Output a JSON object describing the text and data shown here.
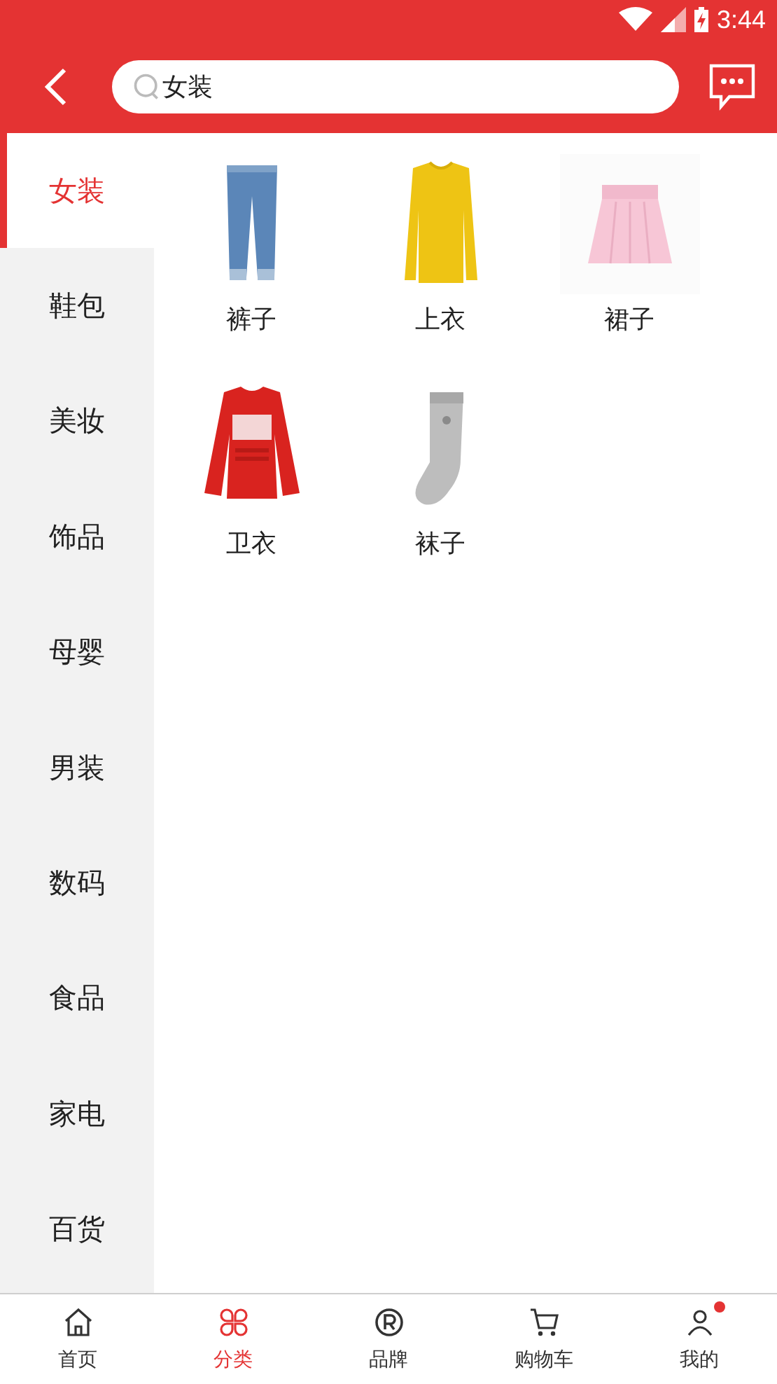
{
  "status_bar": {
    "time": "3:44"
  },
  "header": {
    "search": {
      "value": "女装"
    }
  },
  "sidebar": {
    "items": [
      {
        "label": "女装",
        "selected": true
      },
      {
        "label": "鞋包",
        "selected": false
      },
      {
        "label": "美妆",
        "selected": false
      },
      {
        "label": "饰品",
        "selected": false
      },
      {
        "label": "母婴",
        "selected": false
      },
      {
        "label": "男装",
        "selected": false
      },
      {
        "label": "数码",
        "selected": false
      },
      {
        "label": "食品",
        "selected": false
      },
      {
        "label": "家电",
        "selected": false
      },
      {
        "label": "百货",
        "selected": false
      }
    ]
  },
  "products": [
    {
      "label": "裤子",
      "kind": "pants"
    },
    {
      "label": "上衣",
      "kind": "top"
    },
    {
      "label": "裙子",
      "kind": "skirt"
    },
    {
      "label": "卫衣",
      "kind": "sweater"
    },
    {
      "label": "袜子",
      "kind": "sock"
    }
  ],
  "tab_bar": {
    "items": [
      {
        "label": "首页",
        "kind": "home",
        "selected": false,
        "dot": false
      },
      {
        "label": "分类",
        "kind": "category",
        "selected": true,
        "dot": false
      },
      {
        "label": "品牌",
        "kind": "brand",
        "selected": false,
        "dot": false
      },
      {
        "label": "购物车",
        "kind": "cart",
        "selected": false,
        "dot": false
      },
      {
        "label": "我的",
        "kind": "me",
        "selected": false,
        "dot": true
      }
    ]
  }
}
